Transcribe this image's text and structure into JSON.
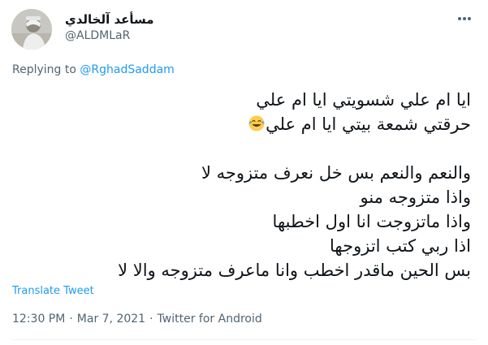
{
  "author": {
    "display_name": "مسأعد آلخالدي",
    "handle": "@ALDMLaR"
  },
  "reply_context": {
    "prefix": "Replying to ",
    "mention": "@RghadSaddam"
  },
  "tweet": {
    "lines": [
      "ايا ام علي شسويتي ايا ام علي",
      "حرقتي شمعة بيتي ايا ام علي",
      "والنعم والنعم بس خل نعرف متزوجه لا",
      "واذا متزوجه منو",
      "واذا ماتزوجت انا اول اخطبها",
      "اذا ربي كتب اتزوجها",
      "بس الحين ماقدر اخطب وانا ماعرف متزوجه والا لا"
    ],
    "emoji": "face-with-tears-of-joy"
  },
  "translate_label": "Translate Tweet",
  "meta": {
    "time": "12:30 PM",
    "separator": "·",
    "date": "Mar 7, 2021",
    "source": "Twitter for Android"
  },
  "colors": {
    "link": "#1d9bf0",
    "secondary_text": "#536471",
    "primary_text": "#0f1419"
  }
}
